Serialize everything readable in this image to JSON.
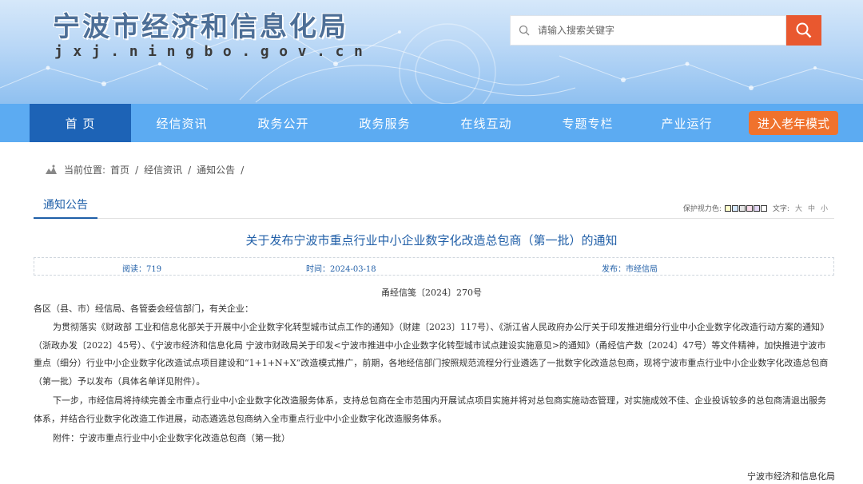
{
  "header": {
    "site_title": "宁波市经济和信息化局",
    "site_domain": "jxj.ningbo.gov.cn",
    "search": {
      "placeholder": "请输入搜索关键字"
    }
  },
  "nav": {
    "items": [
      {
        "label": "首 页",
        "active": true
      },
      {
        "label": "经信资讯",
        "active": false
      },
      {
        "label": "政务公开",
        "active": false
      },
      {
        "label": "政务服务",
        "active": false
      },
      {
        "label": "在线互动",
        "active": false
      },
      {
        "label": "专题专栏",
        "active": false
      },
      {
        "label": "产业运行",
        "active": false
      }
    ],
    "elder_mode_label": "进入老年模式"
  },
  "breadcrumb": {
    "prefix": "当前位置:",
    "items": [
      "首页",
      "经信资讯",
      "通知公告"
    ],
    "separator": "/"
  },
  "section": {
    "title": "通知公告",
    "eye_care_label": "保护视力色:",
    "eye_care_colors": [
      "#ffffcc",
      "#d6e9ff",
      "#e5e5e5",
      "#f8dcea",
      "#e4d8f5",
      "#ffffff"
    ],
    "font_label": "文字:",
    "font_sizes": [
      "大",
      "中",
      "小"
    ]
  },
  "article": {
    "title": "关于发布宁波市重点行业中小企业数字化改造总包商（第一批）的通知",
    "meta": {
      "reads": "阅读：719",
      "time": "时间：2024-03-18",
      "publisher": "发布：市经信局"
    },
    "doc_number": "甬经信笺〔2024〕270号",
    "salutation": "各区（县、市）经信局、各管委会经信部门，有关企业：",
    "paragraph1": "为贯彻落实《财政部 工业和信息化部关于开展中小企业数字化转型城市试点工作的通知》（财建〔2023〕117号）、《浙江省人民政府办公厅关于印发推进细分行业中小企业数字化改造行动方案的通知》（浙政办发〔2022〕45号）、《宁波市经济和信息化局 宁波市财政局关于印发<宁波市推进中小企业数字化转型城市试点建设实施意见>的通知》（甬经信产数〔2024〕47号）等文件精神，加快推进宁波市重点（细分）行业中小企业数字化改造试点项目建设和“1+1+N+X”改造模式推广，前期，各地经信部门按照规范流程分行业遴选了一批数字化改造总包商，现将宁波市重点行业中小企业数字化改造总包商（第一批）予以发布（具体名单详见附件）。",
    "paragraph2": "下一步，市经信局将持续完善全市重点行业中小企业数字化改造服务体系，支持总包商在全市范围内开展试点项目实施并将对总包商实施动态管理，对实施成效不佳、企业投诉较多的总包商清退出服务体系，并结合行业数字化改造工作进展，动态遴选总包商纳入全市重点行业中小企业数字化改造服务体系。",
    "attachment": "附件：宁波市重点行业中小企业数字化改造总包商（第一批）",
    "signature": "宁波市经济和信息化局"
  }
}
